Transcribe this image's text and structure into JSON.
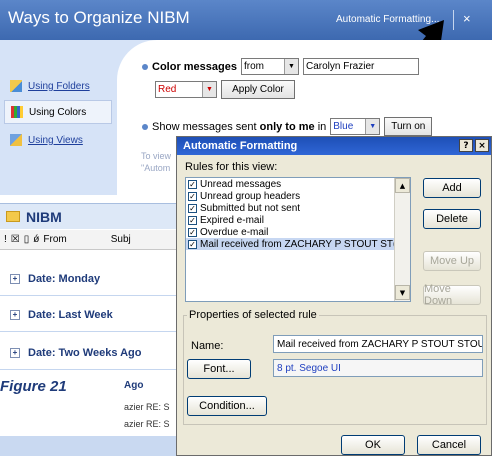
{
  "organize": {
    "title": "Ways to Organize NIBM",
    "auto_format_link": "Automatic Formatting...",
    "close": "×",
    "sidebar": [
      {
        "label": "Using Folders"
      },
      {
        "label": "Using Colors"
      },
      {
        "label": "Using Views"
      }
    ],
    "color_messages_label": "Color messages",
    "from_value": "from",
    "sender_value": "Carolyn Frazier",
    "color_value": "Red",
    "apply_color": "Apply Color",
    "show_prefix": "Show messages sent ",
    "only_to_me": "only to me",
    "in_label": " in",
    "show_color_value": "Blue",
    "turn_on": "Turn on",
    "faint_1": "To view",
    "faint_2": "\"Autom"
  },
  "mail": {
    "folder": "NIBM",
    "col_from": "From",
    "col_subject": "Subj",
    "groups": [
      "Date: Monday",
      "Date: Last Week",
      "Date: Two Weeks Ago"
    ],
    "ago": "Ago",
    "row1": "azier  RE: S",
    "row2": "azier  RE: S",
    "figure": "Figure 21"
  },
  "dialog": {
    "title": "Automatic Formatting",
    "help_btn": "?",
    "close_btn": "×",
    "rules_label": "Rules for this view:",
    "rules": [
      {
        "label": "Unread messages",
        "checked": true
      },
      {
        "label": "Unread group headers",
        "checked": true
      },
      {
        "label": "Submitted but not sent",
        "checked": true
      },
      {
        "label": "Expired e-mail",
        "checked": true
      },
      {
        "label": "Overdue e-mail",
        "checked": true
      },
      {
        "label": "Mail received from ZACHARY P STOUT ST(",
        "checked": true
      }
    ],
    "add": "Add",
    "delete": "Delete",
    "move_up": "Move Up",
    "move_down": "Move Down",
    "properties_label": "Properties of selected rule",
    "name_label": "Name:",
    "name_value": "Mail received from ZACHARY P STOUT STOUT",
    "font_btn": "Font...",
    "font_value": "8 pt. Segoe UI",
    "condition_btn": "Condition...",
    "ok": "OK",
    "cancel": "Cancel"
  }
}
